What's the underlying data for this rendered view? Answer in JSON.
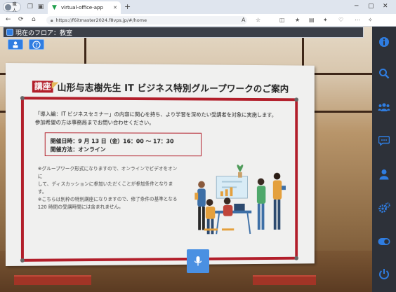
{
  "browser": {
    "profile_label": "職人",
    "tab_title": "virtual-office-app",
    "url": "https://f6itmaster2024.f8vps.jp/#/home"
  },
  "app": {
    "floor_label": "現在のフロア：教室"
  },
  "poster": {
    "badge": "講座",
    "title": "山形与志樹先生 IT ビジネス特別グループワークのご案内",
    "lead_1": "「導入編：IT ビジネスセミナー」の内容に関心を持ち、より学習を深めたい受講者を対象に実施します。",
    "lead_2": "参加希望の方は事務局までお問い合わせください。",
    "schedule_date": "開催日時：9 月 13 日（金）16：00 ～ 17：30",
    "schedule_method": "開催方法：オンライン",
    "note_1": "※グループワーク形式になりますので、オンラインでビデオをオンに",
    "note_2": "して、ディスカッションに参加いただくことが参加条件となります。",
    "note_3": "※こちらは別枠の特別講座になりますので、修了条件の基準となる",
    "note_4": "120 時間の受講時間には含まれません。"
  },
  "colors": {
    "accent_blue": "#2f7de1",
    "poster_red": "#b21e2a",
    "sidebar_bg": "#2d3139"
  }
}
